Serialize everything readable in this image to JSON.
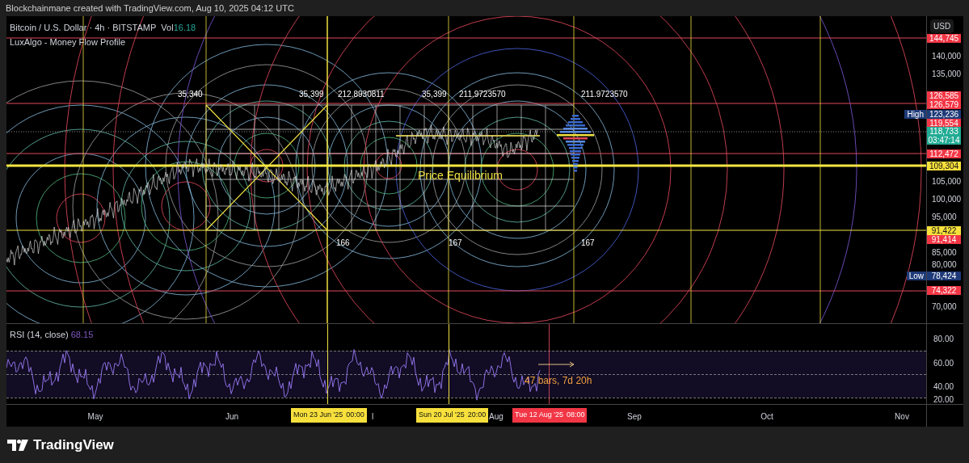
{
  "attribution": "Blockchainmane created with TradingView.com, Aug 10, 2025 04:12 UTC",
  "legend": {
    "symbol": "Bitcoin / U.S. Dollar · 4h · BITSTAMP",
    "volume_label": "Vol",
    "volume_value": "16.18",
    "indicator": "LuxAlgo - Money Flow Profile"
  },
  "chart_labels": [
    {
      "text": "35,340"
    },
    {
      "text": "35,399"
    },
    {
      "text": "212.8930811"
    },
    {
      "text": "35,399"
    },
    {
      "text": "211.9723570"
    },
    {
      "text": "211.9723570"
    },
    {
      "text": "166"
    },
    {
      "text": "167"
    },
    {
      "text": "167"
    }
  ],
  "annotation": "Price Equilibrium",
  "price_axis": {
    "currency": "USD",
    "ticks": [
      "140,000",
      "135,000",
      "105,000",
      "100,000",
      "95,000",
      "85,000",
      "80,000",
      "70,000"
    ],
    "badges": [
      {
        "value": "144,745",
        "color": "#f23645"
      },
      {
        "value": "126,585",
        "color": "#f23645"
      },
      {
        "value": "126,579",
        "color": "#f23645"
      },
      {
        "tag": "High",
        "value": "123,236",
        "color": "#1e3a78"
      },
      {
        "value": "119,554",
        "color": "#f23645"
      },
      {
        "value": "118,733",
        "countdown": "03:47:14",
        "color": "#22ab94"
      },
      {
        "value": "112,472",
        "color": "#f23645"
      },
      {
        "value": "109,304",
        "color": "#f7e03c"
      },
      {
        "value": "91,422",
        "color": "#f7e03c"
      },
      {
        "value": "91,414",
        "color": "#f23645"
      },
      {
        "tag": "Low",
        "value": "78,424",
        "color": "#1e3a78"
      },
      {
        "value": "74,322",
        "color": "#f23645"
      }
    ]
  },
  "rsi": {
    "title": "RSI (14, close)",
    "value": "68.15",
    "ticks": [
      "80.00",
      "60.00",
      "40.00",
      "20.00"
    ],
    "measure": "47 bars, 7d 20h"
  },
  "time_axis": {
    "months": [
      "May",
      "Jun",
      "l",
      "Aug",
      "Sep",
      "Oct",
      "Nov"
    ],
    "crosshair_labels": [
      {
        "date": "Mon 23 Jun '25",
        "time": "00:00",
        "color": "#f7e03c"
      },
      {
        "date": "Sun 20 Jul '25",
        "time": "20:00",
        "color": "#f7e03c"
      },
      {
        "date": "Tue 12 Aug '25",
        "time": "08:00",
        "color": "#f23645"
      }
    ]
  },
  "footer": {
    "brand": "TradingView"
  }
}
